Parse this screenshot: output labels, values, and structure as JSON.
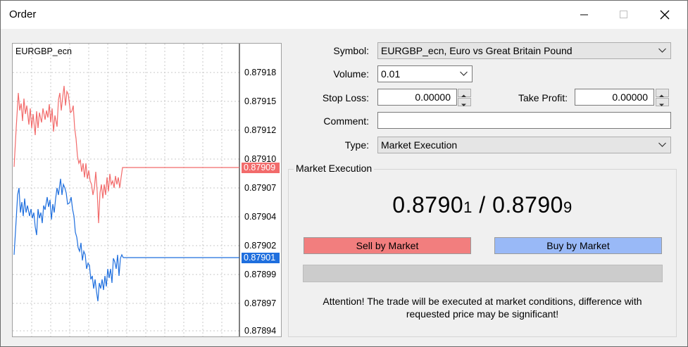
{
  "window": {
    "title": "Order"
  },
  "chart": {
    "symbol": "EURGBP_ecn",
    "price_axis_labels": [
      "0.87918",
      "0.87915",
      "0.87912",
      "0.87910",
      "0.87907",
      "0.87904",
      "0.87902",
      "0.87899",
      "0.87897",
      "0.87894"
    ],
    "ask_tag": "0.87909",
    "bid_tag": "0.87901",
    "ask_color": "#f26b6b",
    "bid_color": "#1f6fde"
  },
  "form": {
    "symbol_label": "Symbol:",
    "symbol_value": "EURGBP_ecn, Euro vs Great Britain Pound",
    "volume_label": "Volume:",
    "volume_value": "0.01",
    "stop_loss_label": "Stop Loss:",
    "stop_loss_value": "0.00000",
    "take_profit_label": "Take Profit:",
    "take_profit_value": "0.00000",
    "comment_label": "Comment:",
    "comment_value": "",
    "type_label": "Type:",
    "type_value": "Market Execution"
  },
  "execution": {
    "group_title": "Market Execution",
    "bid_main": "0.8790",
    "bid_last": "1",
    "separator": " / ",
    "ask_main": "0.8790",
    "ask_last": "9",
    "sell_label": "Sell by Market",
    "buy_label": "Buy by Market",
    "sell_color": "#f27e7e",
    "buy_color": "#99b9f7",
    "notice": "Attention! The trade will be executed at market conditions, difference with requested price may be significant!"
  }
}
